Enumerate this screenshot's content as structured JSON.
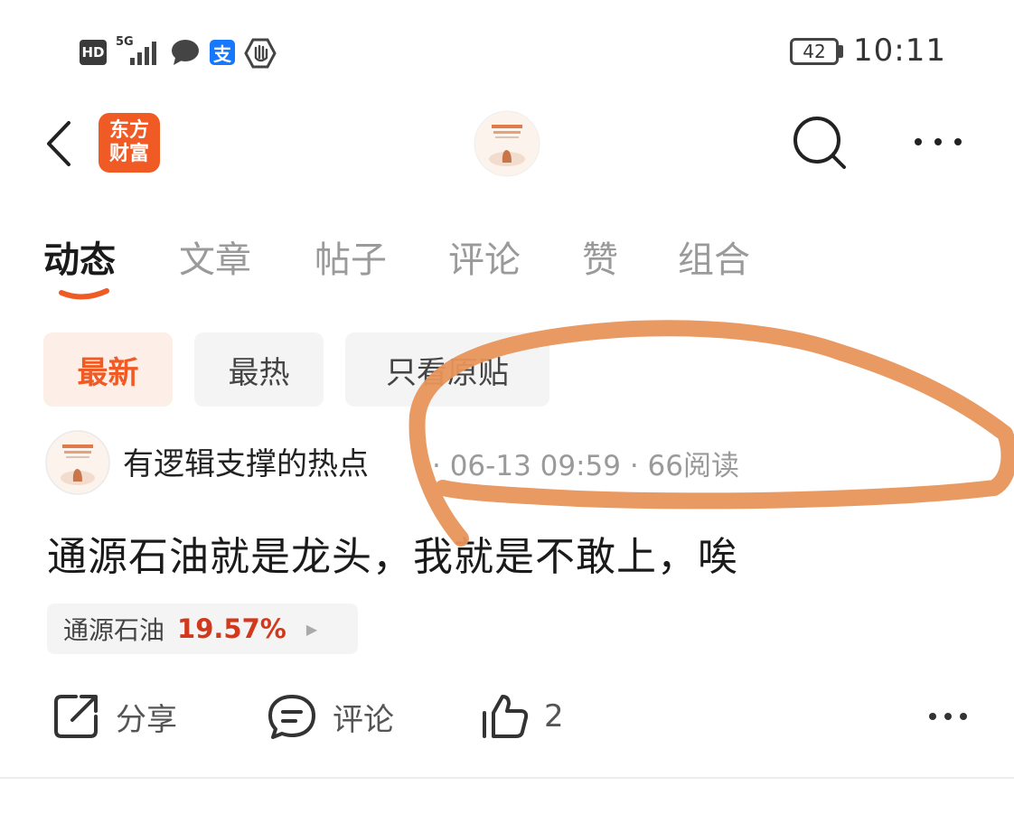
{
  "status_bar": {
    "hd_label": "HD",
    "network_label": "5G",
    "alipay_glyph": "支",
    "battery_level": "42",
    "time": "10:11"
  },
  "nav": {
    "logo_line1": "东方",
    "logo_line2": "财富",
    "icons": [
      "back-arrow-icon",
      "search-icon",
      "more-icon"
    ]
  },
  "tabs": [
    {
      "label": "动态",
      "active": true
    },
    {
      "label": "文章",
      "active": false
    },
    {
      "label": "帖子",
      "active": false
    },
    {
      "label": "评论",
      "active": false
    },
    {
      "label": "赞",
      "active": false
    },
    {
      "label": "组合",
      "active": false
    }
  ],
  "filters": [
    {
      "label": "最新",
      "active": true
    },
    {
      "label": "最热",
      "active": false
    },
    {
      "label": "只看原贴",
      "active": false
    }
  ],
  "post": {
    "author": "有逻辑支撑的热点",
    "meta": "· 06-13 09:59 · 66阅读",
    "content": "通源石油就是龙头，我就是不敢上，唉",
    "stock_tag": {
      "name": "通源石油",
      "change": "19.57%"
    },
    "actions": {
      "share_label": "分享",
      "comment_label": "评论",
      "like_count": "2"
    }
  },
  "colors": {
    "accent": "#f05a24",
    "stock_up": "#d2381b",
    "annotation": "#e8935a"
  }
}
